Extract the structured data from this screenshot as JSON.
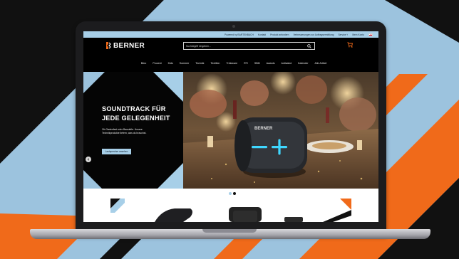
{
  "colors": {
    "accent_orange": "#f06a1a",
    "accent_blue": "#a7cfe8",
    "header_bg": "#000000"
  },
  "topbar": {
    "links": [
      "Powered by BARTENBACH",
      "Kontakt",
      "Produkt anfordern",
      "Verbesserungen zur Auftragsermittlung",
      "Service ˅",
      "Mein Konto"
    ],
    "flag_icon": "swiss-flag-icon"
  },
  "header": {
    "logo_text": "BERNER",
    "search_placeholder": "Suchbegriff eingeben...",
    "search_icon": "search-icon",
    "cart_icon": "cart-icon",
    "cart_count": "0"
  },
  "nav": {
    "items": [
      "Büro",
      "Prozent",
      "Kids",
      "Sommer",
      "Technik",
      "Textilien",
      "Trinkware",
      "RTI",
      "SBM",
      "Awards",
      "Antisalzd",
      "Kalender",
      "Alle Artikel"
    ]
  },
  "hero": {
    "title_line1": "SOUNDTRACK FÜR",
    "title_line2": "JEDE GELEGENHEIT",
    "subtitle": "Ob Gartenfest oder Baustelle. Unsere Technikprodukte liefern, was du brauchst.",
    "cta_label": "Lautsprecher ansehen",
    "speaker_brand": "BERNER",
    "prev_icon": "chevron-left-icon"
  },
  "carousel": {
    "total_slides": 2,
    "active_slide": 2
  }
}
